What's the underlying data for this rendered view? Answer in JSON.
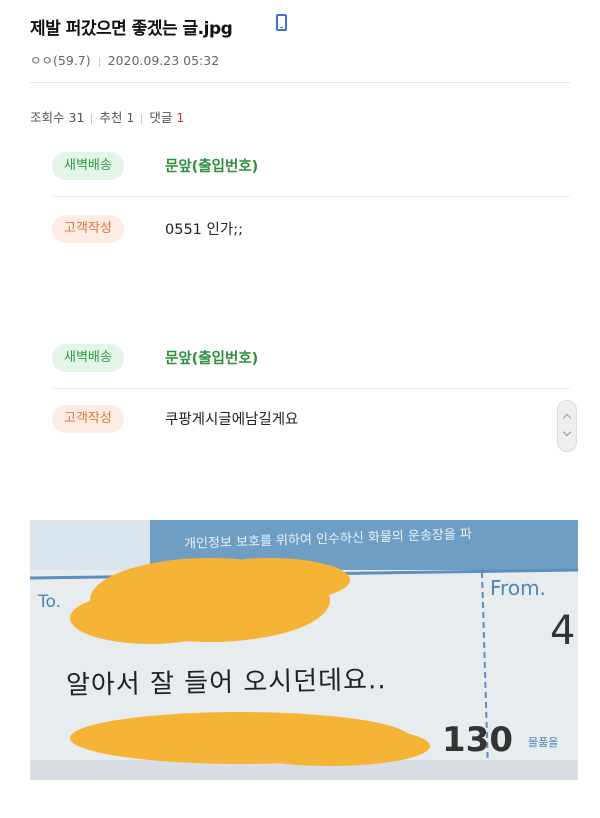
{
  "post": {
    "title": "제발 퍼갔으면 좋겠는 글.jpg",
    "author": "ㅇㅇ(59.7)",
    "datetime": "2020.09.23 05:32"
  },
  "stats": {
    "views_label": "조회수",
    "views": "31",
    "recommend_label": "추천",
    "recommend": "1",
    "comments_label": "댓글",
    "comments": "1"
  },
  "messages": [
    {
      "badge": "새벽배송",
      "text": "문앞(출입번호)"
    },
    {
      "badge": "고객작성",
      "text": "0551 인가;;"
    },
    {
      "badge": "새벽배송",
      "text": "문앞(출입번호)"
    },
    {
      "badge": "고객작성",
      "text": "쿠팡게시글에남길게요"
    }
  ],
  "photo": {
    "banner": "개인정보 보호를 위하여 인수하신 화물의 운송장을 파",
    "to_label": "To.",
    "from_label": "From.",
    "caption": "알아서 잘 들어 오시던데요..",
    "number": "130",
    "item_label": "물품을",
    "partial_digit": "4"
  },
  "colors": {
    "badge_green_bg": "#e4f5e7",
    "badge_green_text": "#2f9a44",
    "badge_orange_bg": "#fdece4",
    "badge_orange_text": "#e0763f",
    "redaction": "#f6b436"
  }
}
